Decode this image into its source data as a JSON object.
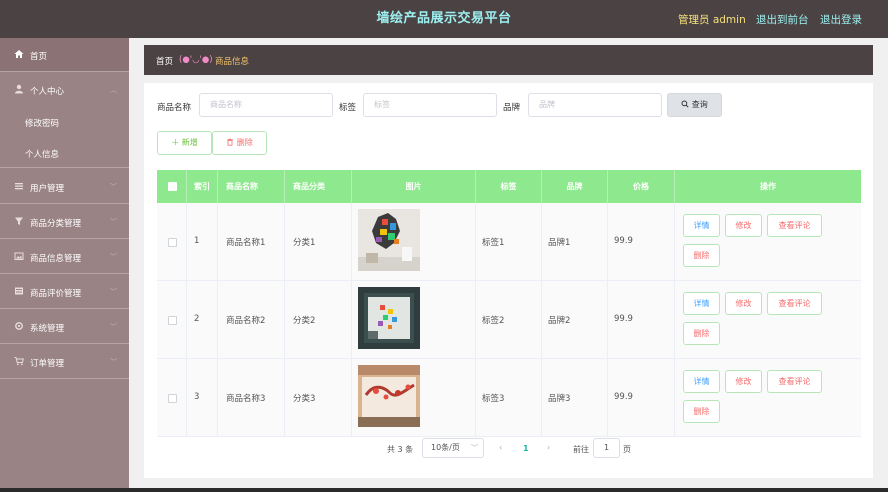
{
  "header": {
    "title": "墙绘产品展示交易平台",
    "admin_label": "管理员 admin",
    "goto_front": "退出到前台",
    "logout": "退出登录"
  },
  "sidebar": {
    "home": "首页",
    "personal_center": "个人中心",
    "change_password": "修改密码",
    "personal_info": "个人信息",
    "user_mgmt": "用户管理",
    "category_mgmt": "商品分类管理",
    "product_mgmt": "商品信息管理",
    "review_mgmt": "商品评价管理",
    "system_mgmt": "系统管理",
    "order_mgmt": "订单管理"
  },
  "breadcrumb": {
    "home": "首页",
    "emoticon": "(●'◡'●)",
    "current": "商品信息"
  },
  "search": {
    "name_label": "商品名称",
    "name_placeholder": "商品名称",
    "tag_label": "标签",
    "tag_placeholder": "标签",
    "brand_label": "品牌",
    "brand_placeholder": "品牌",
    "query_button": "查询"
  },
  "actions": {
    "add": "新增",
    "delete": "删除"
  },
  "table": {
    "headers": {
      "index": "索引",
      "name": "商品名称",
      "category": "商品分类",
      "image": "图片",
      "tag": "标签",
      "brand": "品牌",
      "price": "价格",
      "ops": "操作"
    },
    "rows": [
      {
        "index": "1",
        "name": "商品名称1",
        "category": "分类1",
        "tag": "标签1",
        "brand": "品牌1",
        "price": "99.9"
      },
      {
        "index": "2",
        "name": "商品名称2",
        "category": "分类2",
        "tag": "标签2",
        "brand": "品牌2",
        "price": "99.9"
      },
      {
        "index": "3",
        "name": "商品名称3",
        "category": "分类3",
        "tag": "标签3",
        "brand": "品牌3",
        "price": "99.9"
      }
    ],
    "op_labels": {
      "detail": "详情",
      "edit": "修改",
      "comments": "查看评论",
      "delete": "删除"
    }
  },
  "pagination": {
    "total": "共 3 条",
    "page_size": "10条/页",
    "prev": "‹",
    "current_page": "1",
    "next": "›",
    "goto_label": "前往",
    "goto_value": "1",
    "page_suffix": "页"
  },
  "colors": {
    "header_bg": "#4a4243",
    "title_color": "#9df0f0",
    "admin_color": "#f6e07c",
    "sidebar_bg": "#9a8385",
    "table_header_bg": "#8ee98e",
    "active_page": "#19b6a5"
  }
}
